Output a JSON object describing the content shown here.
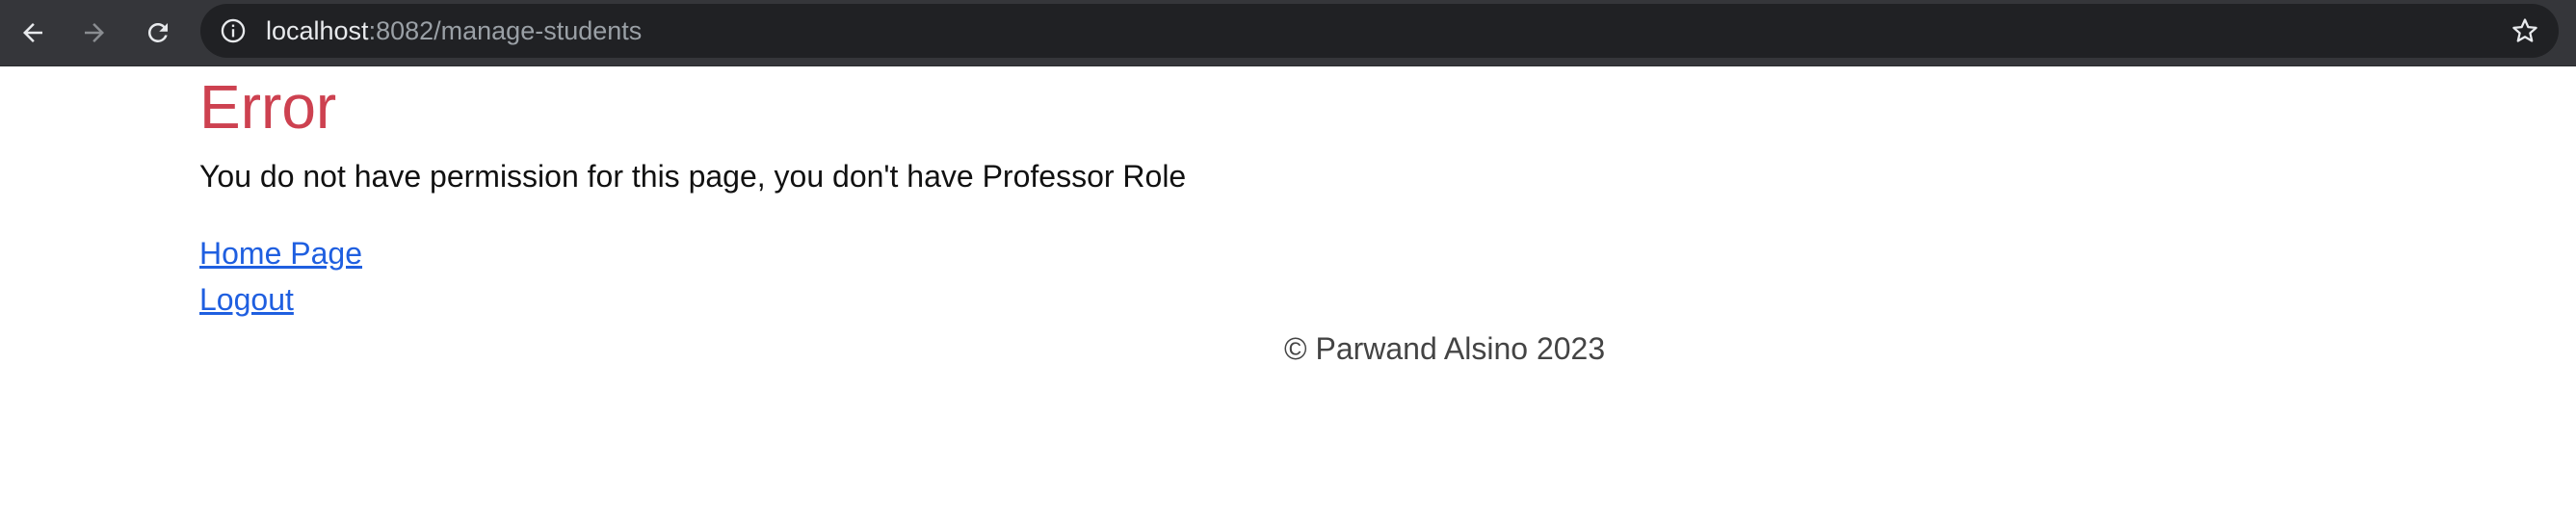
{
  "browser": {
    "url_host": "localhost",
    "url_path": ":8082/manage-students",
    "icons": {
      "back": "arrow-left-icon",
      "forward": "arrow-right-icon",
      "reload": "reload-icon",
      "info": "info-circle-icon",
      "bookmark": "star-icon"
    }
  },
  "page": {
    "title": "Error",
    "message": "You do not have permission for this page, you don't have Professor Role",
    "links": {
      "home": "Home Page",
      "logout": "Logout"
    },
    "footer": "© Parwand Alsino 2023"
  },
  "colors": {
    "title": "#cd4150",
    "link": "#1f5fe0",
    "toolbar": "#35363a",
    "omnibox": "#202124"
  }
}
